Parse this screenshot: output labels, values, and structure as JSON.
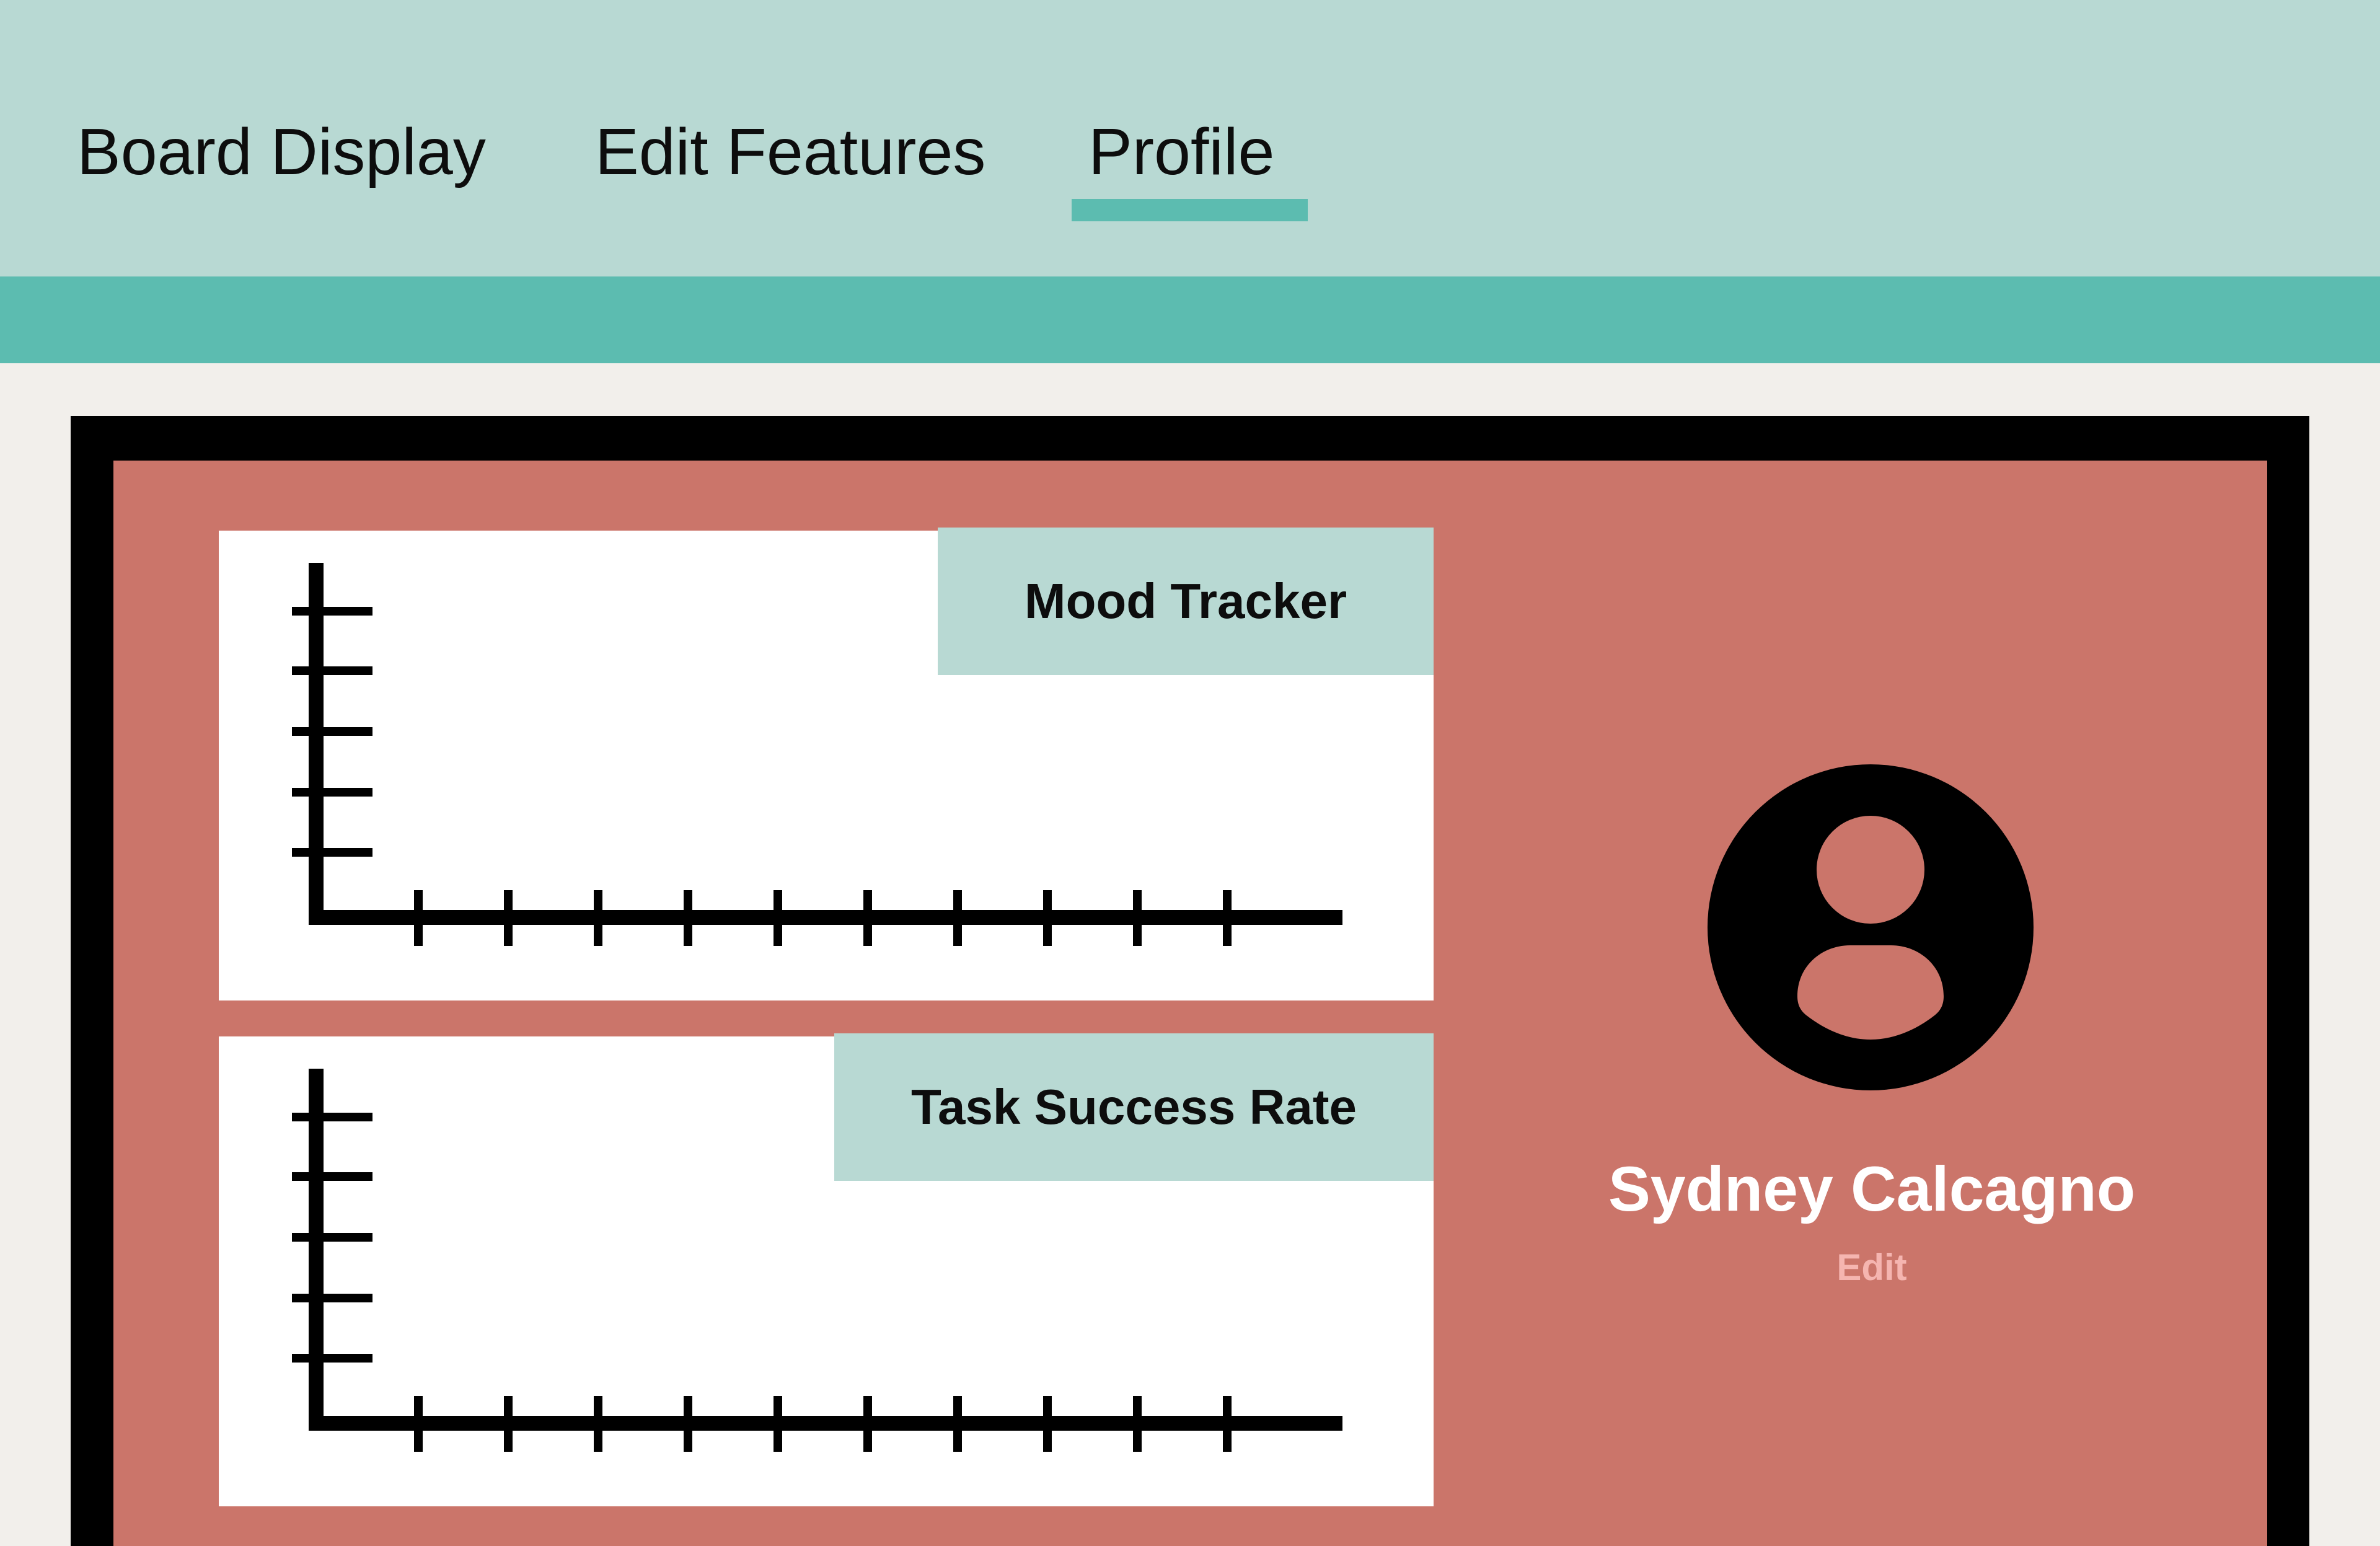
{
  "nav": {
    "tabs": [
      {
        "label": "Board Display"
      },
      {
        "label": "Edit Features"
      },
      {
        "label": "Profile",
        "active": true
      }
    ]
  },
  "charts": [
    {
      "title": "Mood Tracker"
    },
    {
      "title": "Task Success Rate"
    }
  ],
  "profile": {
    "name": "Sydney Calcagno",
    "edit_label": "Edit",
    "avatar_icon": "user-circle-icon"
  },
  "colors": {
    "header_bg": "#b8d9d3",
    "accent": "#5cbcb0",
    "board_bg": "#cb756a",
    "page_bg": "#f2efeb",
    "edit_link": "#f5b5b0"
  }
}
